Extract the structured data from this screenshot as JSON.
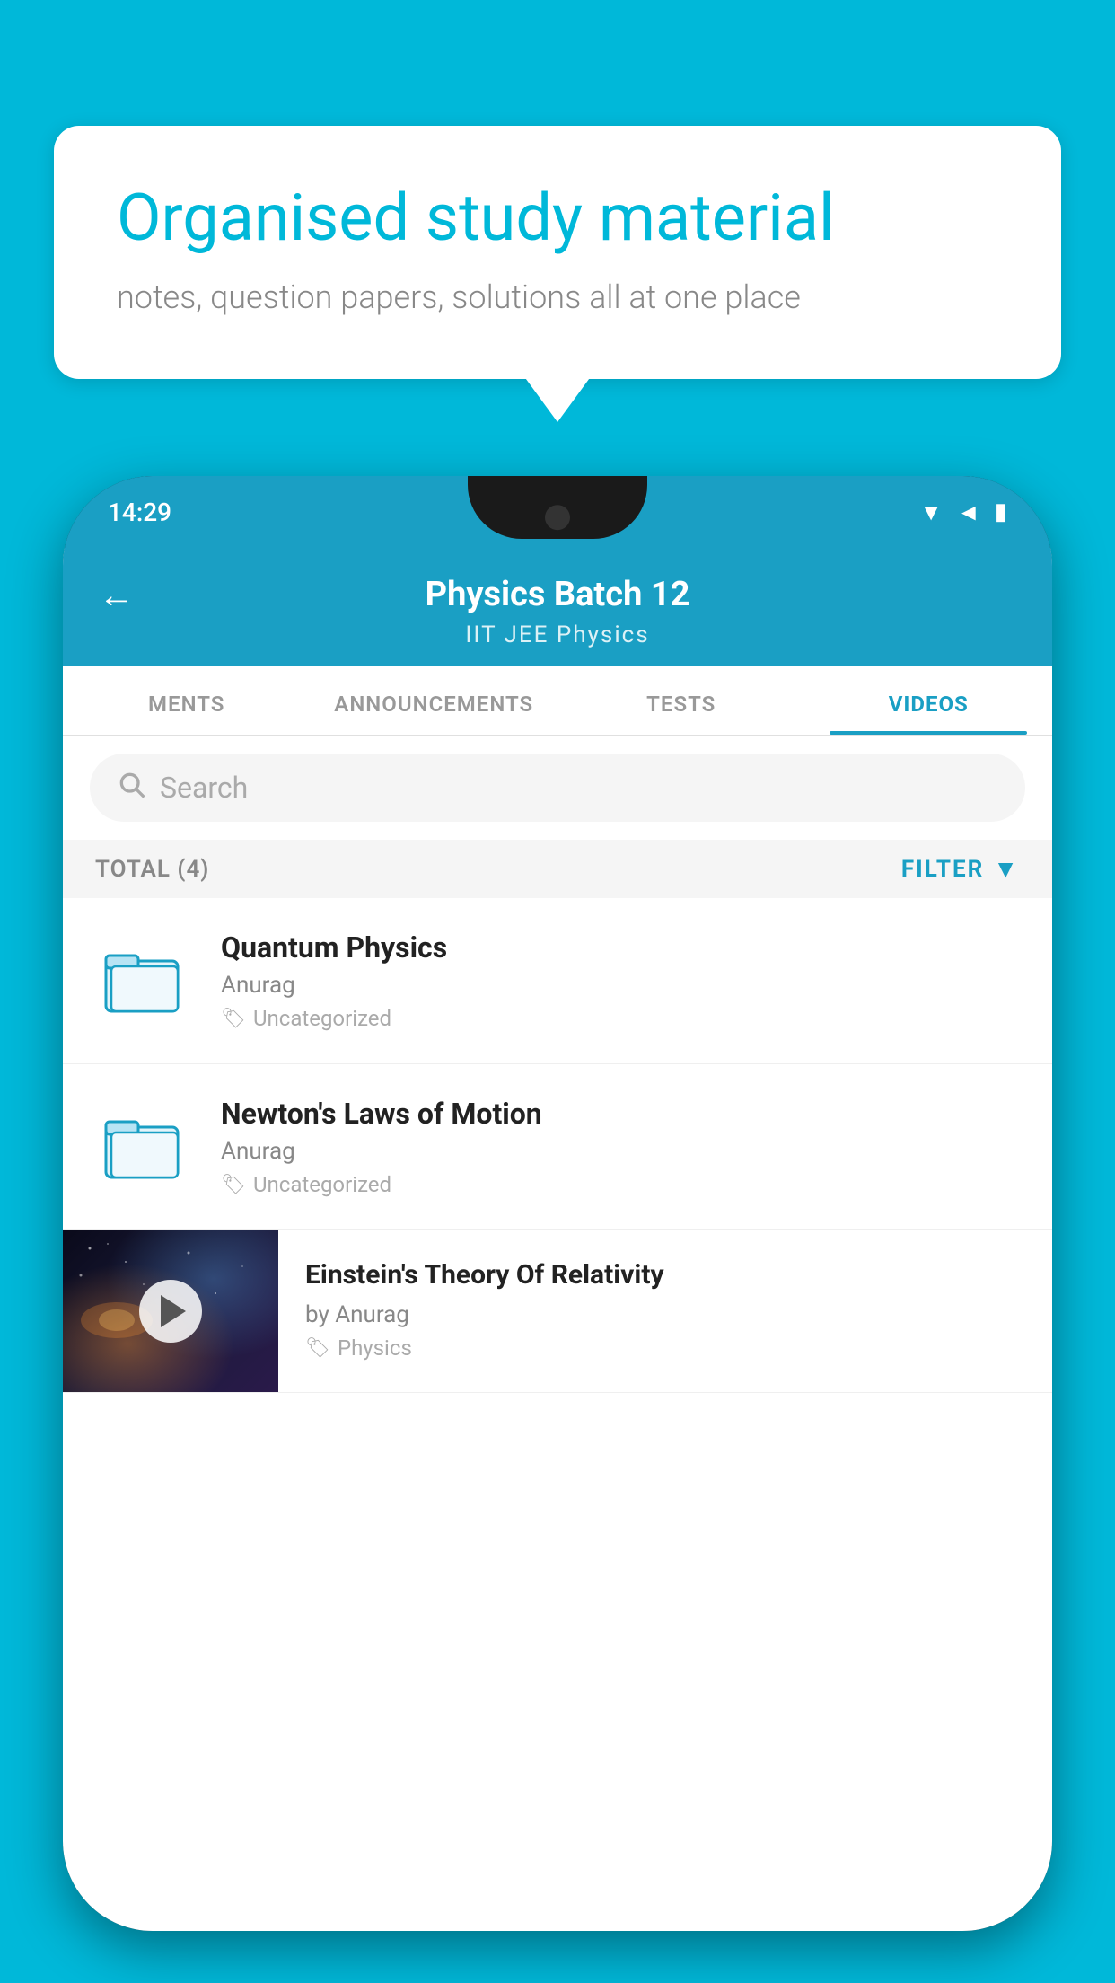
{
  "background_color": "#00B8D9",
  "speech_bubble": {
    "title": "Organised study material",
    "subtitle": "notes, question papers, solutions all at one place"
  },
  "phone": {
    "status_bar": {
      "time": "14:29",
      "icons": [
        "▼",
        "◄",
        "▮"
      ]
    },
    "header": {
      "title": "Physics Batch 12",
      "subtitle": "IIT JEE    Physics",
      "back_label": "←"
    },
    "tabs": [
      {
        "label": "MENTS",
        "active": false
      },
      {
        "label": "ANNOUNCEMENTS",
        "active": false
      },
      {
        "label": "TESTS",
        "active": false
      },
      {
        "label": "VIDEOS",
        "active": true
      }
    ],
    "search": {
      "placeholder": "Search"
    },
    "filter": {
      "total_label": "TOTAL (4)",
      "filter_label": "FILTER"
    },
    "videos": [
      {
        "title": "Quantum Physics",
        "author": "Anurag",
        "tag": "Uncategorized",
        "type": "folder"
      },
      {
        "title": "Newton's Laws of Motion",
        "author": "Anurag",
        "tag": "Uncategorized",
        "type": "folder"
      },
      {
        "title": "Einstein's Theory Of Relativity",
        "author": "by Anurag",
        "tag": "Physics",
        "type": "video"
      }
    ]
  }
}
